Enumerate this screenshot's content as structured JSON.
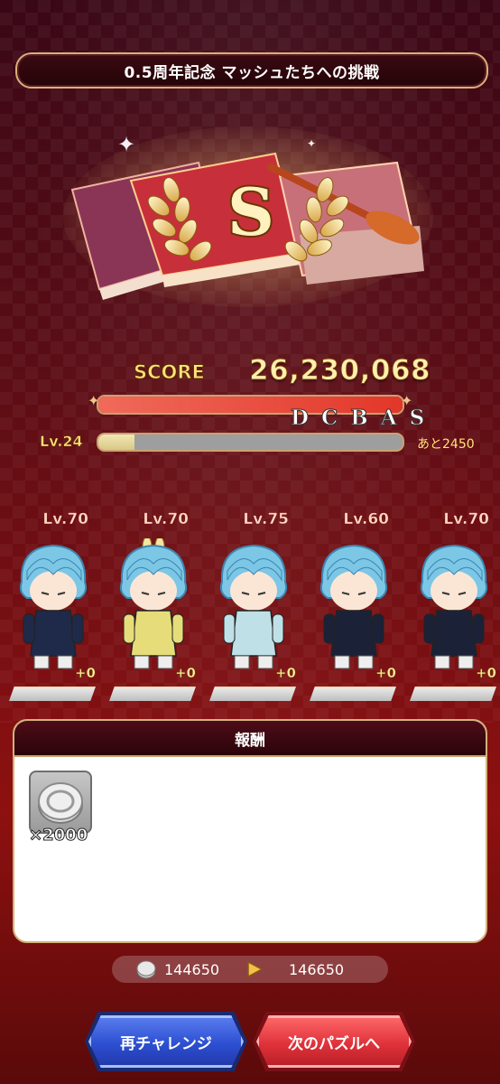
{
  "header": {
    "title": "0.5周年記念 マッシュたちへの挑戦"
  },
  "rank": {
    "grade": "S"
  },
  "score": {
    "label": "SCORE",
    "value": "26,230,068",
    "bar_fill_fraction": 1.0,
    "ranks": [
      "D",
      "C",
      "B",
      "A",
      "S"
    ]
  },
  "player_level": {
    "label": "Lv.24",
    "fill_fraction": 0.12,
    "remaining": "あと2450"
  },
  "characters": [
    {
      "level": "Lv.70",
      "bonus": "+0",
      "outfit_color": "#1f2a4a"
    },
    {
      "level": "Lv.70",
      "bonus": "+0",
      "outfit_color": "#e6dd7a"
    },
    {
      "level": "Lv.75",
      "bonus": "+0",
      "outfit_color": "#bfe0e6"
    },
    {
      "level": "Lv.60",
      "bonus": "+0",
      "outfit_color": "#1b2238"
    },
    {
      "level": "Lv.70",
      "bonus": "+0",
      "outfit_color": "#1b2238"
    }
  ],
  "reward": {
    "title": "報酬",
    "items": [
      {
        "icon": "coin-icon",
        "quantity": "×2000"
      }
    ]
  },
  "currency": {
    "icon": "coin-icon",
    "from": "144650",
    "to": "146650"
  },
  "buttons": {
    "retry": "再チャレンジ",
    "next": "次のパズルへ"
  },
  "colors": {
    "background_top": "#3a0716",
    "background_bottom": "#8e1010",
    "score_text": "#ffe37a",
    "retry_button": "#2c4fd1",
    "next_button": "#e0323a"
  }
}
